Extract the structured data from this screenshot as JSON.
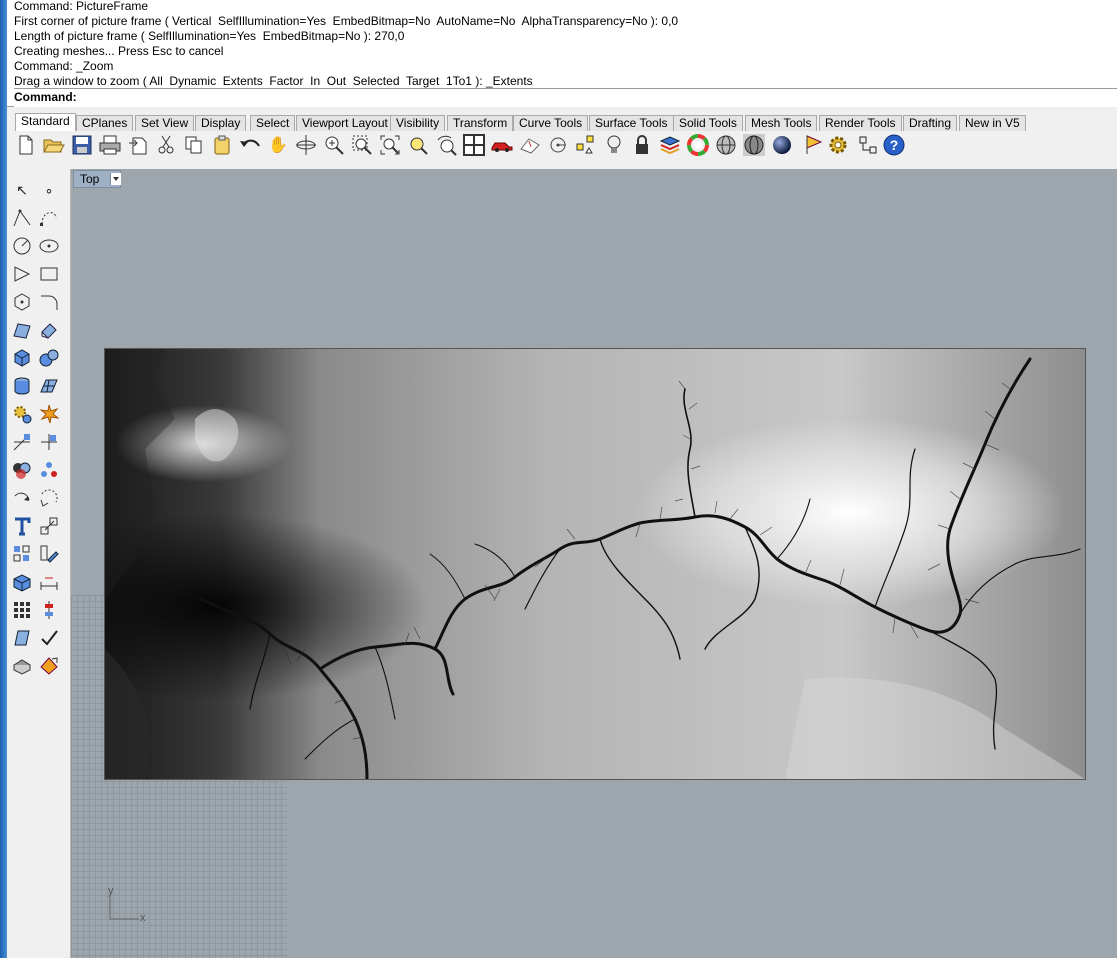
{
  "command_history": [
    "Command: PictureFrame",
    "First corner of picture frame ( Vertical  SelfIllumination=Yes  EmbedBitmap=No  AutoName=No  AlphaTransparency=No ): 0,0",
    "Length of picture frame ( SelfIllumination=Yes  EmbedBitmap=No ): 270,0",
    "Creating meshes... Press Esc to cancel",
    "Command: _Zoom",
    "Drag a window to zoom ( All  Dynamic  Extents  Factor  In  Out  Selected  Target  1To1 ): _Extents"
  ],
  "command_prompt": "Command:",
  "tabs": [
    "Standard",
    "CPlanes",
    "Set View",
    "Display",
    "Select",
    "Viewport Layout",
    "Visibility",
    "Transform",
    "Curve Tools",
    "Surface Tools",
    "Solid Tools",
    "Mesh Tools",
    "Render Tools",
    "Drafting",
    "New in V5"
  ],
  "active_tab": "Standard",
  "toolbar_icons": [
    "new-icon",
    "open-icon",
    "save-icon",
    "print-icon",
    "import-icon",
    "cut-icon",
    "copy-icon",
    "paste-icon",
    "undo-icon",
    "pan-icon",
    "rotate-view-icon",
    "zoom-dynamic-icon",
    "zoom-window-icon",
    "zoom-extents-icon",
    "zoom-selected-icon",
    "undo-view-icon",
    "four-viewports-icon",
    "car-icon",
    "cplane-icon",
    "osnap-icon",
    "points-icon",
    "bulb-icon",
    "lock-icon",
    "layer-icon",
    "color-wheel-icon",
    "shaded-sphere-icon",
    "rendered-sphere-icon",
    "render-icon",
    "flag-icon",
    "gear-icon",
    "dimension-icon",
    "help-icon"
  ],
  "viewport": {
    "name": "Top",
    "axis_y": "y",
    "axis_x": "x"
  },
  "colors": {
    "viewport_bg": "#9ea6ad",
    "viewport_label_bg": "#9eb0c4",
    "window_edge": "#2f75c9"
  }
}
